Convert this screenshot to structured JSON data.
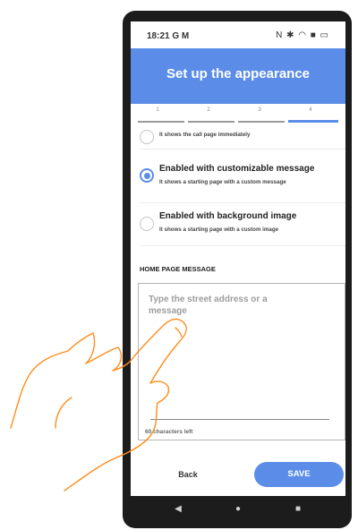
{
  "status_bar": {
    "time": "18:21",
    "left_icons": "G M",
    "right_icons": "N ✱ ◠ ■ ▭"
  },
  "header": {
    "title": "Set up the appearance"
  },
  "stepper": {
    "steps": [
      "1",
      "2",
      "3",
      "4"
    ],
    "current_step": 4
  },
  "options": [
    {
      "title": "",
      "subtitle": "It shows the call page immediately",
      "selected": false
    },
    {
      "title": "Enabled with customizable message",
      "subtitle": "It shows a starting page with a custom message",
      "selected": true
    },
    {
      "title": "Enabled with background image",
      "subtitle": "It shows a starting page with a custom image",
      "selected": false
    }
  ],
  "message": {
    "section_label": "HOME PAGE MESSAGE",
    "placeholder": "Type the street address or a message",
    "chars_left": "60 characters left"
  },
  "actions": {
    "back_label": "Back",
    "save_label": "SAVE"
  },
  "nav": {
    "back_icon": "◀",
    "home_icon": "●",
    "recents_icon": "■"
  },
  "colors": {
    "accent": "#5b8de8",
    "phone_frame": "#1c1c1c"
  }
}
